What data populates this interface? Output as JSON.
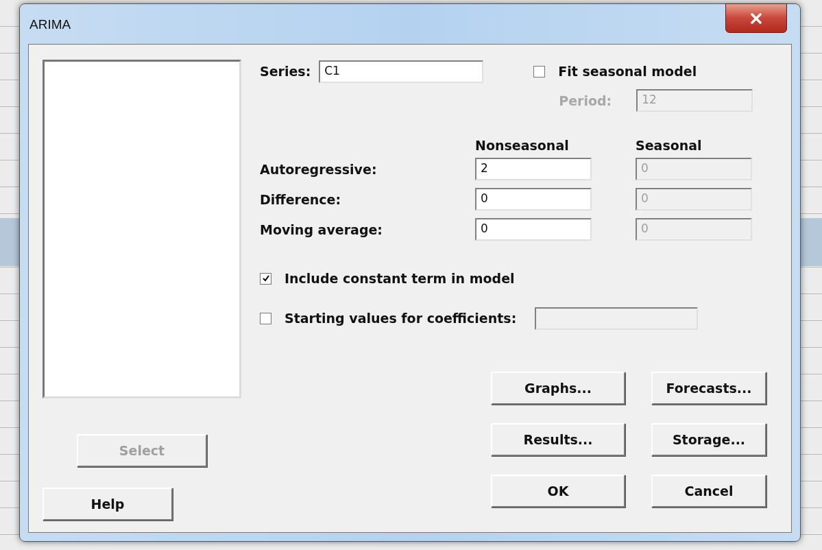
{
  "window": {
    "title": "ARIMA"
  },
  "series": {
    "label": "Series:",
    "value": "C1"
  },
  "fit_seasonal": {
    "label": "Fit seasonal model",
    "checked": false
  },
  "period": {
    "label": "Period:",
    "value": "12",
    "disabled": true
  },
  "columns": [
    "Nonseasonal",
    "Seasonal"
  ],
  "orders": [
    {
      "label": "Autoregressive:",
      "nonseasonal": "2",
      "seasonal": "0",
      "seasonal_disabled": true
    },
    {
      "label": "Difference:",
      "nonseasonal": "0",
      "seasonal": "0",
      "seasonal_disabled": true
    },
    {
      "label": "Moving average:",
      "nonseasonal": "0",
      "seasonal": "0",
      "seasonal_disabled": true
    }
  ],
  "options": [
    {
      "kind": "checkbox",
      "label": "Include constant term in model",
      "checked": true
    },
    {
      "kind": "checkbox_field",
      "label": "Starting values for coefficients:",
      "checked": false,
      "field_disabled": true
    }
  ],
  "select_button": {
    "label": "Select",
    "disabled": true
  },
  "help_button": {
    "label": "Help",
    "disabled": false
  },
  "buttons": [
    {
      "label": "Graphs...",
      "disabled": false
    },
    {
      "label": "Forecasts...",
      "disabled": false
    },
    {
      "label": "Results...",
      "disabled": false
    },
    {
      "label": "Storage...",
      "disabled": false
    },
    {
      "label": "OK",
      "disabled": false
    },
    {
      "label": "Cancel",
      "disabled": false
    }
  ]
}
